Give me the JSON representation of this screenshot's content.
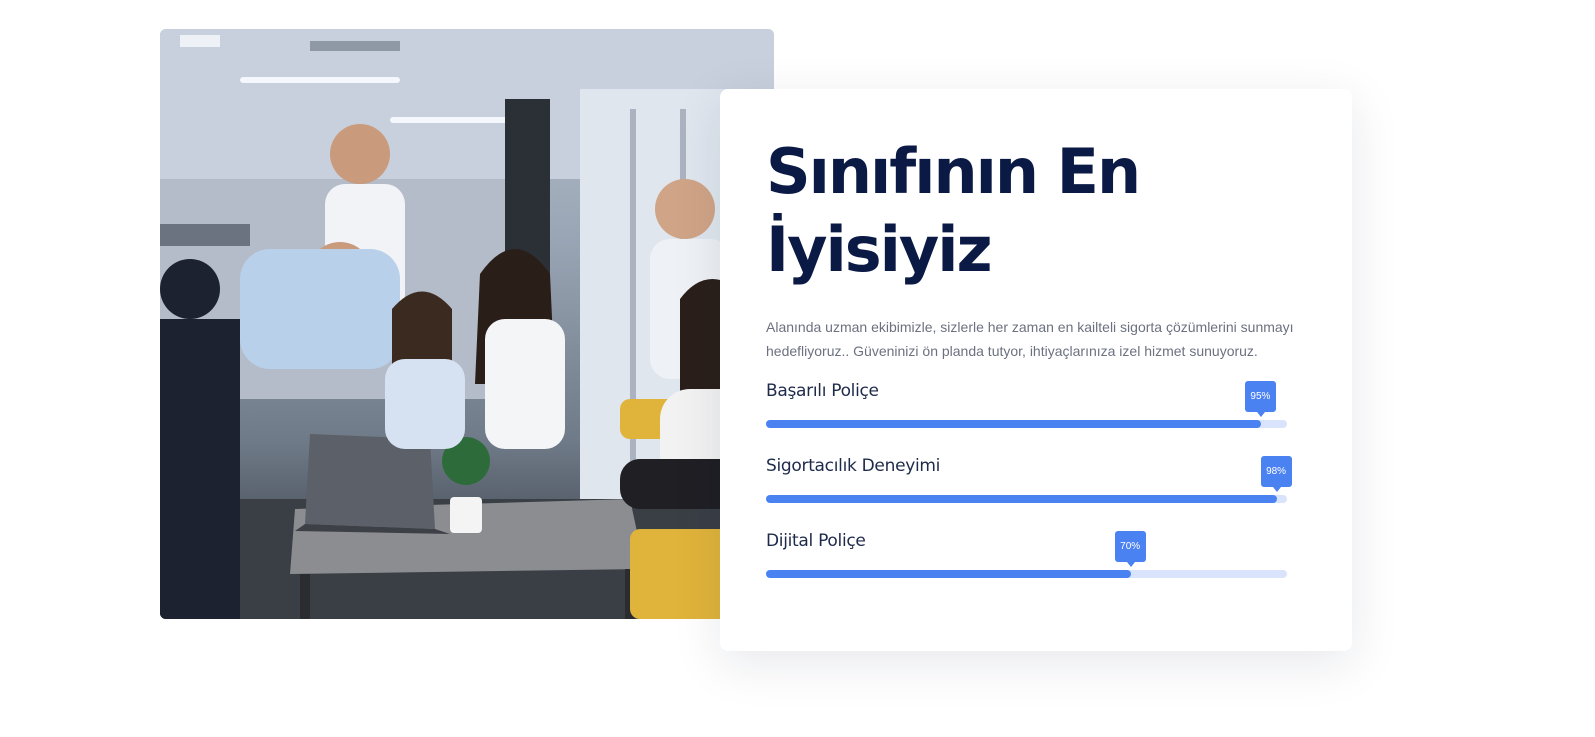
{
  "photo": {
    "alt": "Ekip toplantısı"
  },
  "card": {
    "title_line1": "Sınıfının En",
    "title_line2": "İyisiyiz",
    "description": "Alanında uzman ekibimizle, sizlerle her zaman en kailteli sigorta çözümlerini sunmayı hedefliyoruz.. Güveninizi ön planda tutyor, ihtiyaçlarınıza izel hizmet sunuyoruz."
  },
  "skills": [
    {
      "label": "Başarılı Poliçe",
      "percent": 95,
      "badge": "95%"
    },
    {
      "label": "Sigortacılık Deneyimi",
      "percent": 98,
      "badge": "98%"
    },
    {
      "label": "Dijital Poliçe",
      "percent": 70,
      "badge": "70%"
    }
  ],
  "colors": {
    "heading": "#0b1a45",
    "accent": "#4b82f1",
    "track": "#d9e3fb",
    "text_muted": "#6b7180"
  }
}
